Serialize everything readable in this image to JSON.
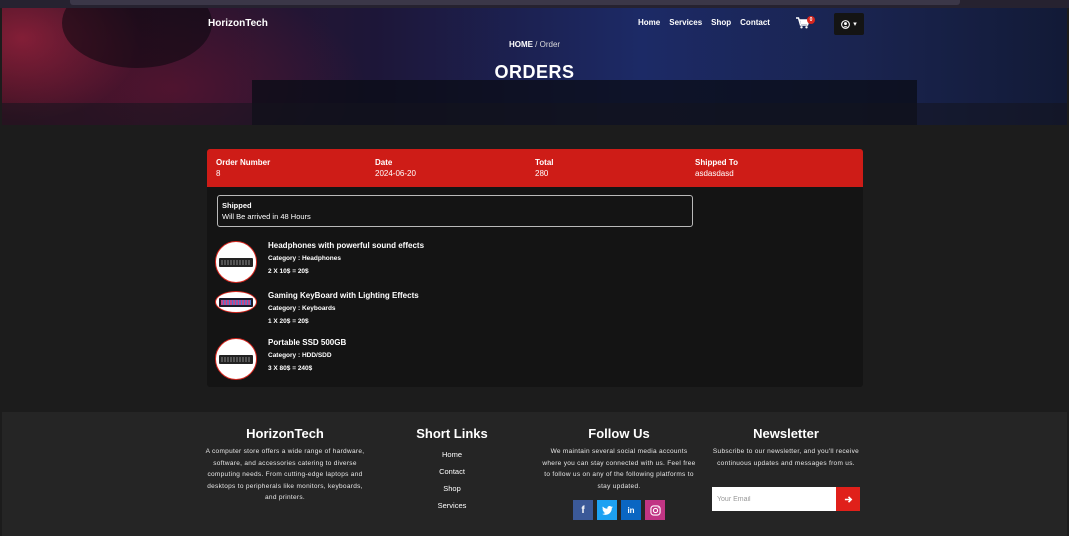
{
  "nav": {
    "brand": "HorizonTech",
    "links": [
      "Home",
      "Services",
      "Shop",
      "Contact"
    ],
    "cart_count": "0"
  },
  "hero": {
    "breadcrumb_home": "HOME",
    "breadcrumb_sep": " / ",
    "breadcrumb_current": "Order",
    "title": "ORDERS"
  },
  "order": {
    "headers": {
      "number_label": "Order Number",
      "date_label": "Date",
      "total_label": "Total",
      "shipped_label": "Shipped To"
    },
    "values": {
      "number": "8",
      "date": "2024-06-20",
      "total": "280",
      "shipped_to": "asdasdasd"
    },
    "status": "Shipped",
    "status_note": "Will Be arrived in 48 Hours",
    "items": [
      {
        "name": "Headphones with powerful sound effects",
        "category": "Category : Headphones",
        "price": "2 X 10$ = 20$"
      },
      {
        "name": "Gaming KeyBoard with Lighting Effects",
        "category": "Category : Keyboards",
        "price": "1 X 20$ = 20$"
      },
      {
        "name": "Portable SSD 500GB",
        "category": "Category : HDD/SDD",
        "price": "3 X 80$ = 240$"
      }
    ]
  },
  "footer": {
    "about_title": "HorizonTech",
    "about_text": "A computer store offers a wide range of hardware, software, and accessories catering to diverse computing needs. From cutting-edge laptops and desktops to peripherals like monitors, keyboards, and printers.",
    "links_title": "Short Links",
    "links": [
      "Home",
      "Contact",
      "Shop",
      "Services"
    ],
    "follow_title": "Follow Us",
    "follow_text": "We maintain several social media accounts where you can stay connected with us. Feel free to follow us on any of the following platforms to stay updated.",
    "socials": [
      "facebook-icon",
      "twitter-icon",
      "linkedin-icon",
      "instagram-icon"
    ],
    "newsletter_title": "Newsletter",
    "newsletter_text": "Subscribe to our newsletter, and you'll receive continuous updates and messages from us.",
    "email_placeholder": "Your Email"
  },
  "colors": {
    "accent": "#ce1c17",
    "background": "#1c1c1c",
    "card": "#141414",
    "footer": "#252525"
  }
}
